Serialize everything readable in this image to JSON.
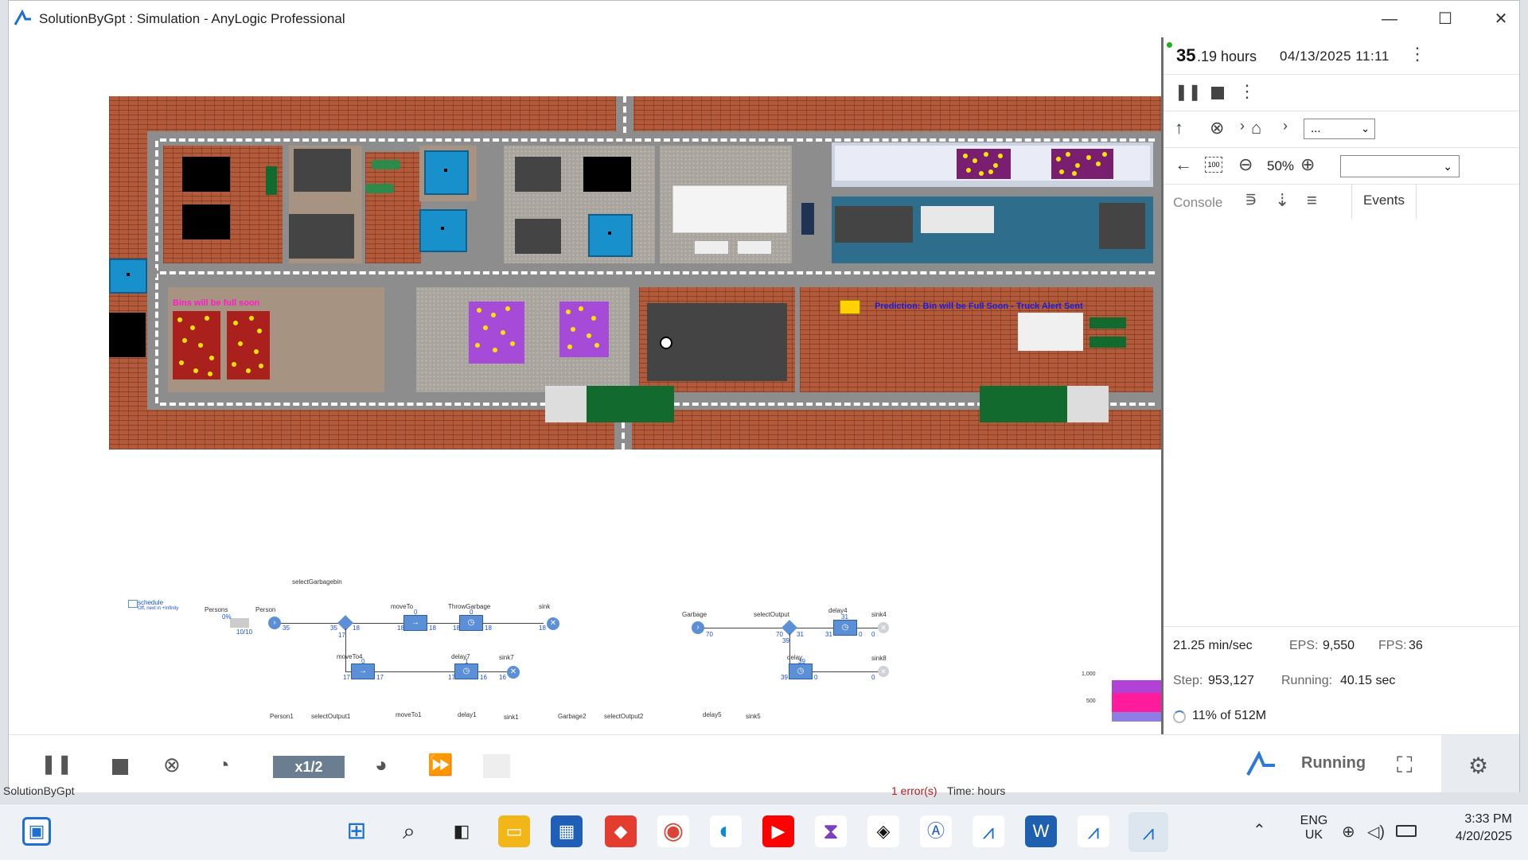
{
  "window": {
    "title": "SolutionByGpt : Simulation - AnyLogic Professional",
    "controls": {
      "minimize": "—",
      "maximize": "☐",
      "close": "✕"
    }
  },
  "sim_panel": {
    "time_big": "35",
    "time_small": ".19 hours",
    "date": "04/13/2025 11:11",
    "zoom": "50%",
    "breadcrumb_select": "...",
    "view_select": "",
    "tab_console": "Console",
    "tab_events": "Events",
    "speed_rate": "21.25 min/sec",
    "eps_label": "EPS:",
    "eps_value": "9,550",
    "fps_label": "FPS:",
    "fps_value": "36",
    "step_label": "Step:",
    "step_value": "953,127",
    "running_label": "Running:",
    "running_value": "40.15 sec",
    "memory": "11% of 512M"
  },
  "map": {
    "bins_message": "Bins will be full soon",
    "prediction_message": "Prediction: Bin will be Full Soon - Truck Alert Sent"
  },
  "flowchart": {
    "labels": {
      "selectGarbagebin": "selectGarbagebin",
      "schedule": "schedule",
      "schedule_sub": "Off, next in +Infinity",
      "persons": "Persons",
      "person": "Person",
      "moveTo": "moveTo",
      "throwGarbage": "ThrowGarbage",
      "sink": "sink",
      "moveTo4": "moveTo4",
      "delay7": "delay7",
      "sink7": "sink7",
      "garbage": "Garbage",
      "selectOutput": "selectOutput",
      "delay4": "delay4",
      "sink4": "sink4",
      "delay": "delay",
      "sink8": "sink8",
      "person1": "Person1",
      "selectOutput1": "selectOutput1",
      "moveTo1": "moveTo1",
      "delay1": "delay1",
      "sink1": "sink1",
      "garbage2": "Garbage2",
      "selectOutput2": "selectOutput2",
      "delay5": "delay5",
      "sink5": "sink5"
    },
    "counts": {
      "persons_pct": "0%",
      "persons_cap": "10/10",
      "person_out": "35",
      "sel_in": "35",
      "sel_out_a": "18",
      "sel_out_b": "17",
      "moveTo_top": "0",
      "moveTo_in": "18",
      "moveTo_out": "18",
      "throw_top": "0",
      "throw_in": "18",
      "throw_out": "18",
      "sink_in": "18",
      "moveTo4_top": "0",
      "moveTo4_in": "17",
      "moveTo4_out": "17",
      "delay7_top": "1",
      "delay7_in": "17",
      "delay7_out": "16",
      "sink7_in": "16",
      "garbage_out": "70",
      "so_in": "70",
      "so_out_a": "31",
      "so_out_b": "39",
      "delay4_top": "31",
      "delay4_in": "31",
      "delay4_out": "0",
      "delay_top": "39",
      "delay_in": "39",
      "delay_out": "0",
      "sink4_in": "0",
      "sink8_in": "0"
    },
    "mini_chart": {
      "y_top": "1,000",
      "y_mid": "500"
    }
  },
  "toolbar": {
    "speed": "x1/2",
    "status": "Running"
  },
  "behind_text": {
    "status_left": "SolutionByGpt",
    "error": "1 error(s)",
    "time_units": "Time: hours"
  },
  "taskbar": {
    "lang_top": "ENG",
    "lang_bottom": "UK",
    "clock_time": "3:33 PM",
    "clock_date": "4/20/2025"
  },
  "colors": {
    "brick": "#b35a3a",
    "road": "#8d8d8d",
    "accent_blue": "#1890cc",
    "bin_purple": "#a64bd8",
    "bin_red": "#a9201c",
    "truck_green": "#136a2e"
  }
}
